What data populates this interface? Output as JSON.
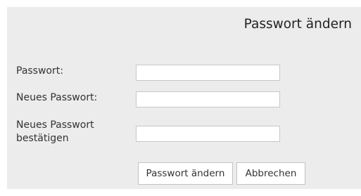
{
  "form": {
    "title": "Passwort ändern",
    "fields": [
      {
        "label": "Passwort:",
        "value": ""
      },
      {
        "label": "Neues Passwort:",
        "value": ""
      },
      {
        "label_line1": "Neues Passwort",
        "label_line2": "bestätigen",
        "value": ""
      }
    ],
    "submit_label": "Passwort ändern",
    "cancel_label": "Abbrechen"
  }
}
